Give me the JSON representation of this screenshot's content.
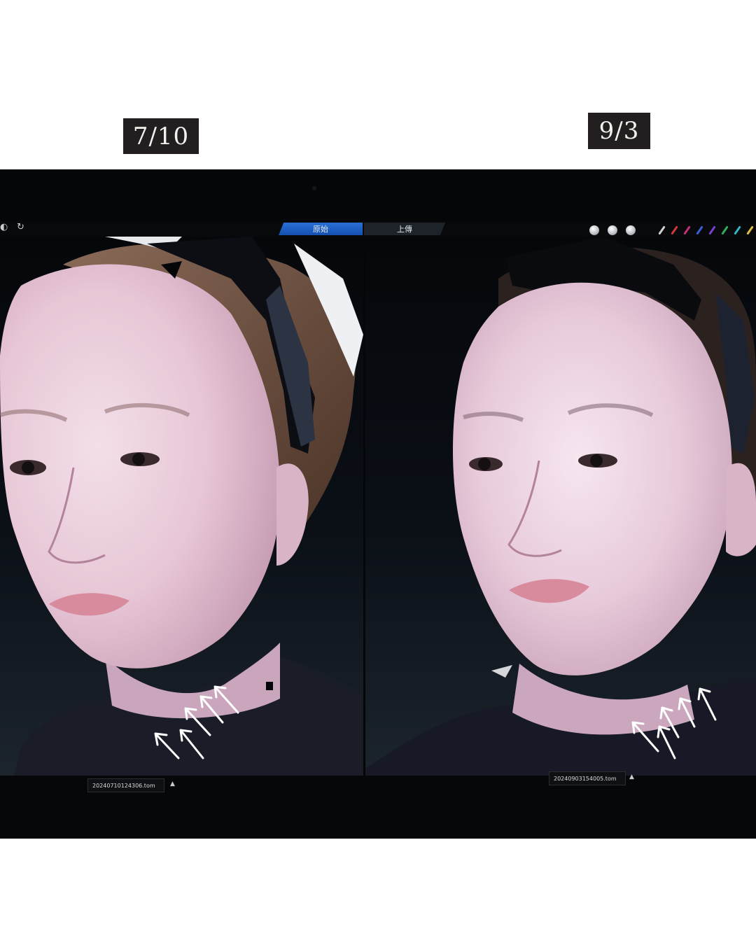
{
  "labels": {
    "before_date": "7/10",
    "after_date": "9/3"
  },
  "viewer": {
    "tab_active": "原始",
    "tab_inactive": "上傳",
    "file_before": "20240710124306.tom",
    "file_after": "20240903154005.tom",
    "caret": "▲",
    "rotate_icon": "rotate-icon"
  },
  "colors": {
    "label_bg": "#231f20",
    "tab_active": "#1f62c8",
    "arrow": "#ffffff"
  }
}
